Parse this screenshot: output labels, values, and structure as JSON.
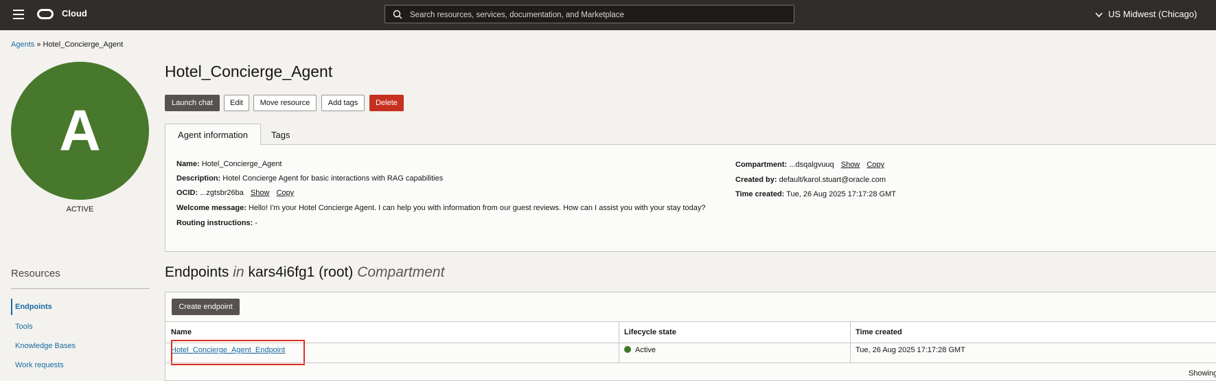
{
  "header": {
    "brand": "Cloud",
    "search_placeholder": "Search resources, services, documentation, and Marketplace",
    "region": "US Midwest (Chicago)"
  },
  "breadcrumb": {
    "parent": "Agents",
    "separator": "»",
    "current": "Hotel_Concierge_Agent"
  },
  "avatar": {
    "letter": "A",
    "status": "ACTIVE",
    "color": "#48782b"
  },
  "resources": {
    "title": "Resources",
    "items": [
      "Endpoints",
      "Tools",
      "Knowledge Bases",
      "Work requests"
    ]
  },
  "page": {
    "title": "Hotel_Concierge_Agent"
  },
  "actions": {
    "launch_chat": "Launch chat",
    "edit": "Edit",
    "move_resource": "Move resource",
    "add_tags": "Add tags",
    "delete": "Delete"
  },
  "tabs": [
    "Agent information",
    "Tags"
  ],
  "info": {
    "name_label": "Name:",
    "name_value": "Hotel_Concierge_Agent",
    "description_label": "Description:",
    "description_value": "Hotel Concierge Agent for basic interactions with RAG capabilities",
    "ocid_label": "OCID:",
    "ocid_value": "...zgtsbr26ba",
    "show": "Show",
    "copy": "Copy",
    "welcome_label": "Welcome message:",
    "welcome_value": "Hello! I'm your Hotel Concierge Agent. I can help you with information from our guest reviews. How can I assist you with your stay today?",
    "routing_label": "Routing instructions:",
    "routing_value": "-",
    "compartment_label": "Compartment:",
    "compartment_value": "...dsqalgvuuq",
    "created_by_label": "Created by:",
    "created_by_value": "default/karol.stuart@oracle.com",
    "time_created_label": "Time created:",
    "time_created_value": "Tue, 26 Aug 2025 17:17:28 GMT"
  },
  "endpoints": {
    "title_main": "Endpoints",
    "title_in": "in",
    "title_compartment": "kars4i6fg1 (root)",
    "title_suffix": "Compartment",
    "create_button": "Create endpoint",
    "columns": [
      "Name",
      "Lifecycle state",
      "Time created"
    ],
    "rows": [
      {
        "name": "Hotel_Concierge_Agent_Endpoint",
        "state": "Active",
        "time_created": "Tue, 26 Aug 2025 17:17:28 GMT"
      }
    ],
    "showing": "Showing"
  }
}
